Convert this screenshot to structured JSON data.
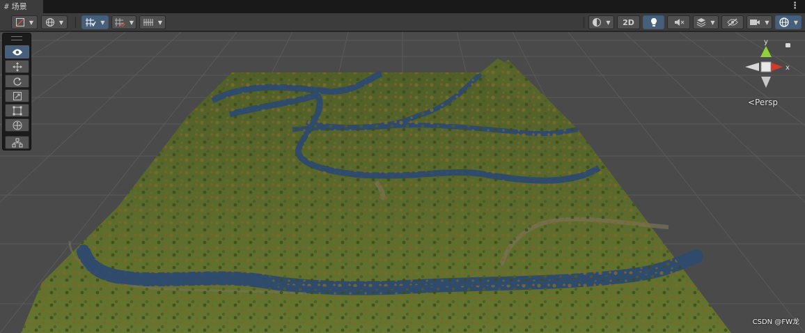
{
  "tab": {
    "icon": "#",
    "title": "场景"
  },
  "toolbar": {
    "btn_2d_label": "2D",
    "menu_icon": "⋮"
  },
  "gizmo": {
    "y_label": "y",
    "x_label": "x",
    "projection_label": "<Persp"
  },
  "watermark": "CSDN @FW龙",
  "colors": {
    "accent": "#46607c",
    "terrain": "#5a6a2e",
    "water": "#2f4b6b",
    "grid_bg": "#4a4a4a",
    "gizmo_y": "#8fd238",
    "gizmo_x": "#d23a2a"
  }
}
